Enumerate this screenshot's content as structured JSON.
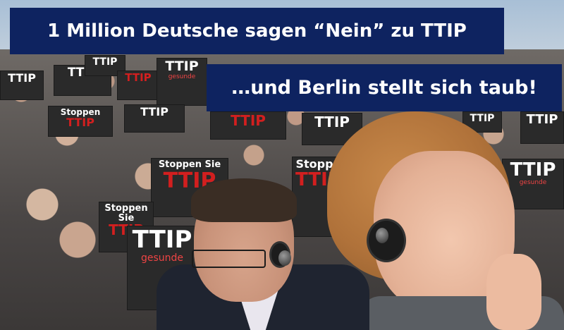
{
  "headline": {
    "line1": "1 Million Deutsche sagen “Nein” zu TTIP",
    "line2": "…und Berlin stellt sich taub!"
  },
  "signs": {
    "ttip": "TTIP",
    "gesunde": "gesunde",
    "stoppen_sie": "Stoppen Sie",
    "stopp": "Stopp",
    "stoppen": "Stoppen"
  },
  "colors": {
    "banner": "#0e2360",
    "banner_text": "#ffffff",
    "sign_bg": "#2a2a2a",
    "sign_accent": "#d21f1f"
  }
}
